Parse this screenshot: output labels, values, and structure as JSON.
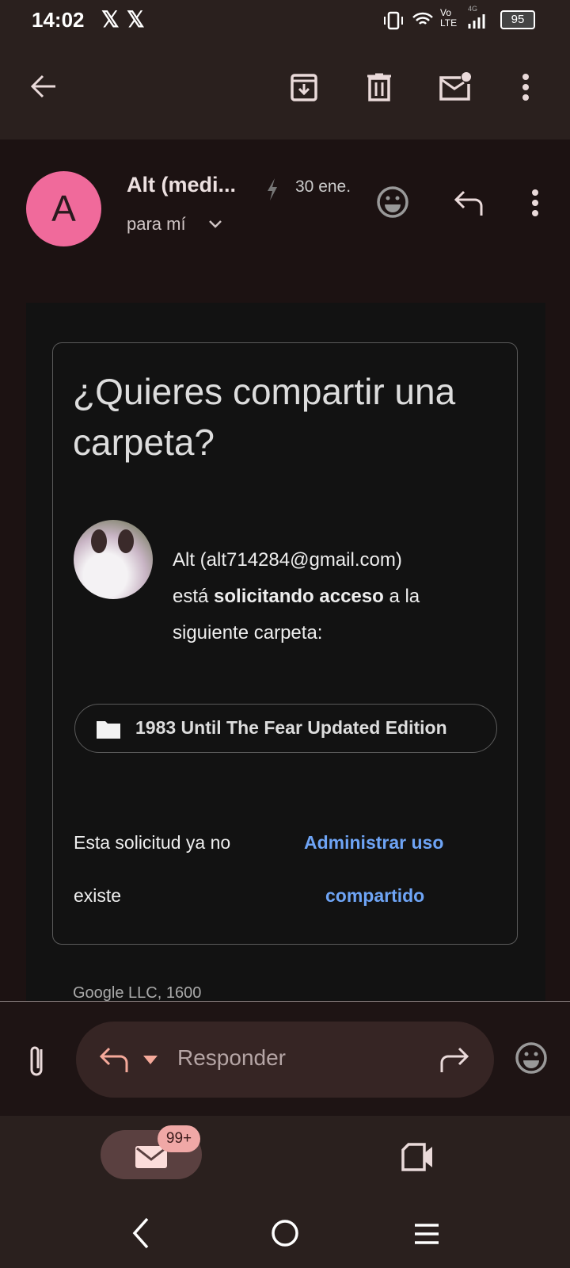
{
  "status_bar": {
    "time": "14:02",
    "notif_icons": [
      "x-icon",
      "x-icon"
    ],
    "network": "Vo LTE",
    "network_type": "4G",
    "battery": "95"
  },
  "toolbar": {
    "icons": [
      "back-arrow-icon",
      "archive-icon",
      "trash-icon",
      "mark-unread-icon",
      "more-vert-icon"
    ]
  },
  "email": {
    "avatar_letter": "A",
    "avatar_color": "#f06a9b",
    "sender": "Alt (medi...",
    "date": "30 ene.",
    "recipient": "para mí"
  },
  "card": {
    "title": "¿Quieres compartir una carpeta?",
    "requester": "Alt (alt714284@gmail.com)",
    "text_before": "está ",
    "text_bold": "solicitando acceso",
    "text_after": " a la siguiente carpeta:",
    "folder": "1983 Until The Fear Updated Edition",
    "status_line1": "Esta solicitud ya no",
    "status_line2": "existe",
    "link_line1": "Administrar uso",
    "link_line2": "compartido",
    "footer": "Google LLC, 1600"
  },
  "reply_bar": {
    "placeholder": "Responder"
  },
  "bottom_nav": {
    "mail_badge": "99+"
  }
}
